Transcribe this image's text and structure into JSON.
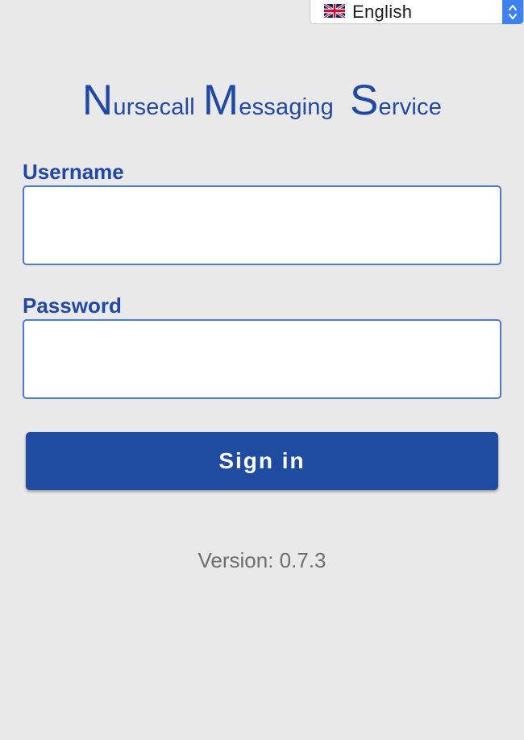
{
  "language_selector": {
    "selected": "English",
    "flag_icon": "uk-flag-icon",
    "stepper_icon": "up-down-chevron-icon",
    "accent_color": "#3b82f0"
  },
  "title": {
    "word1_initial": "N",
    "word1_rest": "ursecall",
    "word2_initial": "M",
    "word2_rest": "essaging",
    "word3_initial": "S",
    "word3_rest": "ervice",
    "color": "#2149a3"
  },
  "form": {
    "username": {
      "label": "Username",
      "value": "",
      "placeholder": ""
    },
    "password": {
      "label": "Password",
      "value": "",
      "placeholder": ""
    },
    "signin_label": "Sign in",
    "button_color": "#1f4ba0"
  },
  "footer": {
    "version": "Version: 0.7.3"
  }
}
